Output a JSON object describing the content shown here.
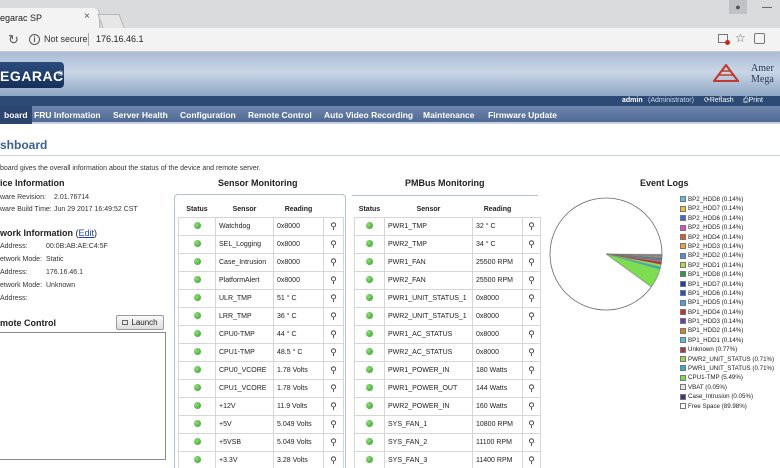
{
  "browser": {
    "tab_title": "egarac SP",
    "tab_close": "×",
    "security": "Not secure",
    "url": "176.16.46.1"
  },
  "header": {
    "logo": "EGARAC",
    "brand_line1": "Amer",
    "brand_line2": "Mega",
    "user": "admin",
    "role": "(Administrator)",
    "refresh": "Reflash",
    "print": "Print"
  },
  "nav": [
    "board",
    "FRU Information",
    "Server Health",
    "Configuration",
    "Remote Control",
    "Auto Video Recording",
    "Maintenance",
    "Firmware Update"
  ],
  "page": {
    "title": "shboard",
    "description": "board gives the overall information about the status of the device and remote server."
  },
  "device_info": {
    "title": "ice Information",
    "rows": [
      {
        "label": "ware Revision:",
        "value": "2.01.76714"
      },
      {
        "label": "ware Build Time:",
        "value": "Jun 29 2017 16:49:52 CST"
      }
    ]
  },
  "network_info": {
    "title": "work Information",
    "edit": "Edit",
    "rows": [
      {
        "label": "Address:",
        "value": "00:0B:AB:AE:C4:5F"
      },
      {
        "label": "etwork Mode:",
        "value": "Static"
      },
      {
        "label": "Address:",
        "value": "176.16.46.1"
      },
      {
        "label": "etwork Mode:",
        "value": "Unknown"
      },
      {
        "label": "Address:",
        "value": ""
      }
    ]
  },
  "remote_control": {
    "title": "mote Control",
    "launch": "Launch"
  },
  "sensor_monitoring": {
    "title": "Sensor Monitoring",
    "headers": [
      "Status",
      "Sensor",
      "Reading"
    ],
    "rows": [
      {
        "sensor": "Watchdog",
        "reading": "0x8000"
      },
      {
        "sensor": "SEL_Logging",
        "reading": "0x8000"
      },
      {
        "sensor": "Case_Intrusion",
        "reading": "0x8000"
      },
      {
        "sensor": "PlatformAlert",
        "reading": "0x8000"
      },
      {
        "sensor": "ULR_TMP",
        "reading": "51 ° C"
      },
      {
        "sensor": "LRR_TMP",
        "reading": "36 ° C"
      },
      {
        "sensor": "CPU0-TMP",
        "reading": "44 ° C"
      },
      {
        "sensor": "CPU1-TMP",
        "reading": "48.5 ° C"
      },
      {
        "sensor": "CPU0_VCORE",
        "reading": "1.78 Volts"
      },
      {
        "sensor": "CPU1_VCORE",
        "reading": "1.78 Volts"
      },
      {
        "sensor": "+12V",
        "reading": "11.9 Volts"
      },
      {
        "sensor": "+5V",
        "reading": "5.049 Volts"
      },
      {
        "sensor": "+5VSB",
        "reading": "5.049 Volts"
      },
      {
        "sensor": "+3.3V",
        "reading": "3.28 Volts"
      }
    ]
  },
  "pmbus_monitoring": {
    "title": "PMBus Monitoring",
    "headers": [
      "Status",
      "Sensor",
      "Reading"
    ],
    "rows": [
      {
        "sensor": "PWR1_TMP",
        "reading": "32 ° C"
      },
      {
        "sensor": "PWR2_TMP",
        "reading": "34 ° C"
      },
      {
        "sensor": "PWR1_FAN",
        "reading": "25500 RPM"
      },
      {
        "sensor": "PWR2_FAN",
        "reading": "25500 RPM"
      },
      {
        "sensor": "PWR1_UNIT_STATUS_1",
        "reading": "0x8000"
      },
      {
        "sensor": "PWR2_UNIT_STATUS_1",
        "reading": "0x8000"
      },
      {
        "sensor": "PWR1_AC_STATUS",
        "reading": "0x8000"
      },
      {
        "sensor": "PWR2_AC_STATUS",
        "reading": "0x8000"
      },
      {
        "sensor": "PWR1_POWER_IN",
        "reading": "180 Watts"
      },
      {
        "sensor": "PWR1_POWER_OUT",
        "reading": "144 Watts"
      },
      {
        "sensor": "PWR2_POWER_IN",
        "reading": "160 Watts"
      },
      {
        "sensor": "SYS_FAN_1",
        "reading": "10800 RPM"
      },
      {
        "sensor": "SYS_FAN_2",
        "reading": "11100 RPM"
      },
      {
        "sensor": "SYS_FAN_3",
        "reading": "11400 RPM"
      }
    ]
  },
  "event_logs": {
    "title": "Event Logs",
    "legend": [
      {
        "label": "BP2_HDD8 (0.14%)",
        "color": "#5bc0de",
        "pct": 0.14
      },
      {
        "label": "BP2_HDD7 (0.14%)",
        "color": "#e8c430",
        "pct": 0.14
      },
      {
        "label": "BP2_HDD6 (0.14%)",
        "color": "#3b6fd8",
        "pct": 0.14
      },
      {
        "label": "BP2_HDD5 (0.14%)",
        "color": "#d94dc4",
        "pct": 0.14
      },
      {
        "label": "BP2_HDD4 (0.14%)",
        "color": "#e05a2b",
        "pct": 0.14
      },
      {
        "label": "BP2_HDD3 (0.14%)",
        "color": "#f0a830",
        "pct": 0.14
      },
      {
        "label": "BP2_HDD2 (0.14%)",
        "color": "#4a8fd9",
        "pct": 0.14
      },
      {
        "label": "BP2_HDD1 (0.14%)",
        "color": "#b5d93a",
        "pct": 0.14
      },
      {
        "label": "BP1_HDD8 (0.14%)",
        "color": "#2f9a44",
        "pct": 0.14
      },
      {
        "label": "BP1_HDD7 (0.14%)",
        "color": "#1f3fa8",
        "pct": 0.14
      },
      {
        "label": "BP1_HDD6 (0.14%)",
        "color": "#2255cc",
        "pct": 0.14
      },
      {
        "label": "BP1_HDD5 (0.14%)",
        "color": "#4aa0e0",
        "pct": 0.14
      },
      {
        "label": "BP1_HDD4 (0.14%)",
        "color": "#c23030",
        "pct": 0.14
      },
      {
        "label": "BP1_HDD3 (0.14%)",
        "color": "#6e3fa8",
        "pct": 0.14
      },
      {
        "label": "BP1_HDD2 (0.14%)",
        "color": "#e07a2b",
        "pct": 0.14
      },
      {
        "label": "BP1_HDD1 (0.14%)",
        "color": "#5ab8e8",
        "pct": 0.14
      },
      {
        "label": "Unknown (0.77%)",
        "color": "#a83a3a",
        "pct": 0.77
      },
      {
        "label": "PWR2_UNIT_STATUS (0.71%)",
        "color": "#9ad94a",
        "pct": 0.71
      },
      {
        "label": "PWR1_UNIT_STATUS (0.71%)",
        "color": "#2fb0c8",
        "pct": 0.71
      },
      {
        "label": "CPU1-TMP (5.49%)",
        "color": "#7ddc50",
        "pct": 5.49
      },
      {
        "label": "VBAT (0.05%)",
        "color": "#e6e6e6",
        "pct": 0.05
      },
      {
        "label": "Case_Intrusion (0.05%)",
        "color": "#3a3a7a",
        "pct": 0.05
      },
      {
        "label": "Free Space (89.98%)",
        "color": "#ffffff",
        "pct": 89.98
      }
    ]
  }
}
